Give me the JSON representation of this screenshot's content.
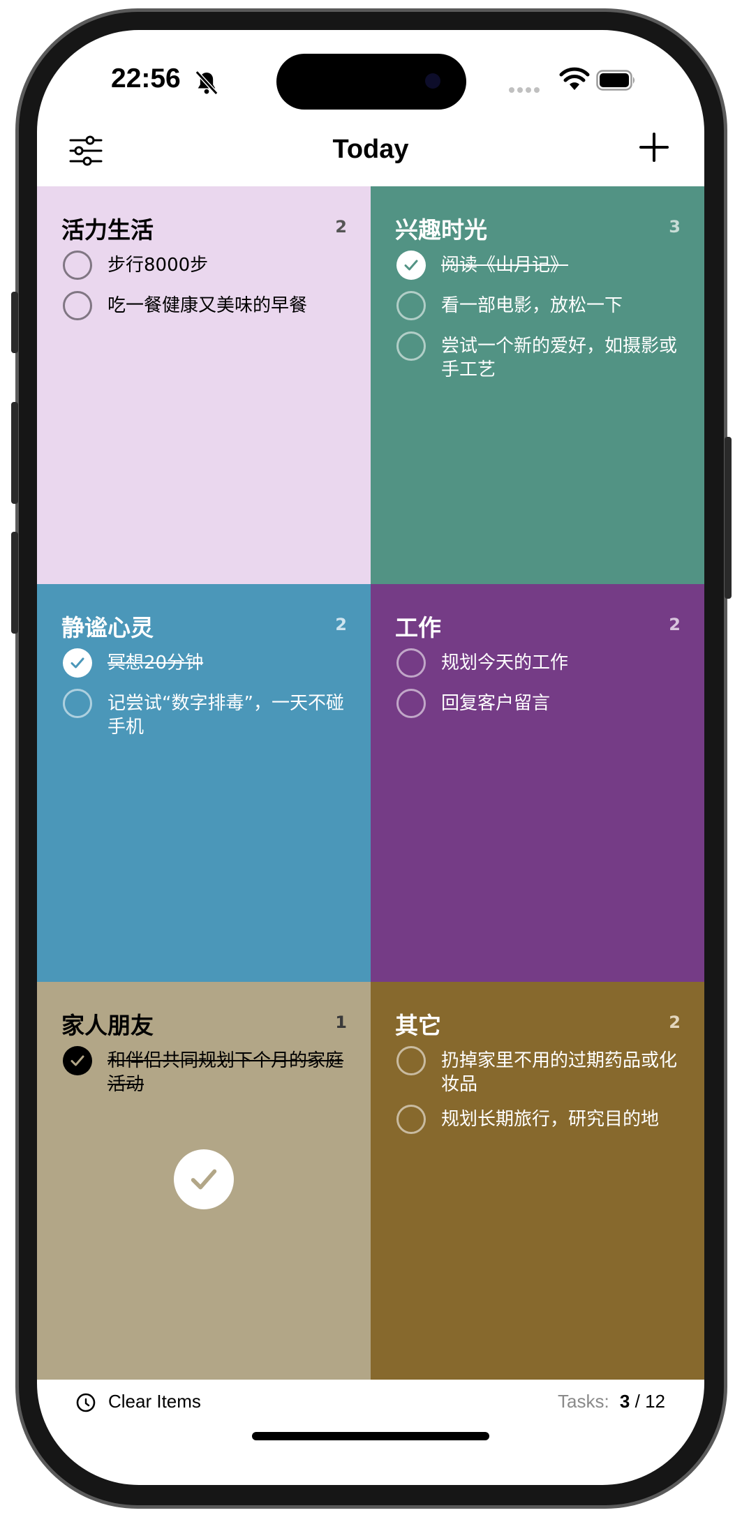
{
  "status_bar": {
    "time": "22:56",
    "silent_icon": "bell-slash-icon",
    "wifi_icon": "wifi-icon",
    "battery_icon": "battery-icon"
  },
  "nav": {
    "title": "Today",
    "filter_icon": "sliders-icon",
    "add_icon": "plus-icon"
  },
  "quadrants": [
    {
      "title": "活力生活",
      "count": "2",
      "bg": "#ead7ee",
      "fg": "#000000",
      "count_color": "#555555",
      "tasks": [
        {
          "text": "步行8000步",
          "done": false
        },
        {
          "text": "吃一餐健康又美味的早餐",
          "done": false
        }
      ]
    },
    {
      "title": "兴趣时光",
      "count": "3",
      "bg": "#529384",
      "fg": "#ffffff",
      "count_color": "#c8ddd7",
      "tasks": [
        {
          "text": "阅读《山月记》",
          "done": true
        },
        {
          "text": "看一部电影，放松一下",
          "done": false
        },
        {
          "text": "尝试一个新的爱好，如摄影或手工艺",
          "done": false
        }
      ]
    },
    {
      "title": "静谧心灵",
      "count": "2",
      "bg": "#4b97b9",
      "fg": "#ffffff",
      "count_color": "#cfe4ef",
      "tasks": [
        {
          "text": "冥想20分钟",
          "done": true
        },
        {
          "text": "记尝试“数字排毒”，一天不碰手机",
          "done": false
        }
      ]
    },
    {
      "title": "工作",
      "count": "2",
      "bg": "#753c86",
      "fg": "#ffffff",
      "count_color": "#d9c6de",
      "tasks": [
        {
          "text": "规划今天的工作",
          "done": false
        },
        {
          "text": "回复客户留言",
          "done": false
        }
      ]
    },
    {
      "title": "家人朋友",
      "count": "1",
      "bg": "#b2a687",
      "fg": "#000000",
      "count_color": "#3a3a3a",
      "tasks": [
        {
          "text": "和伴侣共同规划下个月的家庭活动",
          "done": true
        }
      ],
      "complete_badge": "checkmark-circle-icon"
    },
    {
      "title": "其它",
      "count": "2",
      "bg": "#87692d",
      "fg": "#ffffff",
      "count_color": "#e3d6bd",
      "tasks": [
        {
          "text": "扔掉家里不用的过期药品或化妆品",
          "done": false
        },
        {
          "text": "规划长期旅行，研究目的地",
          "done": false
        }
      ]
    }
  ],
  "footer": {
    "clear_label": "Clear Items",
    "clear_icon": "clear-timer-icon",
    "tasks_label": "Tasks:",
    "done_count": "3",
    "separator": "/",
    "total_count": "12"
  }
}
